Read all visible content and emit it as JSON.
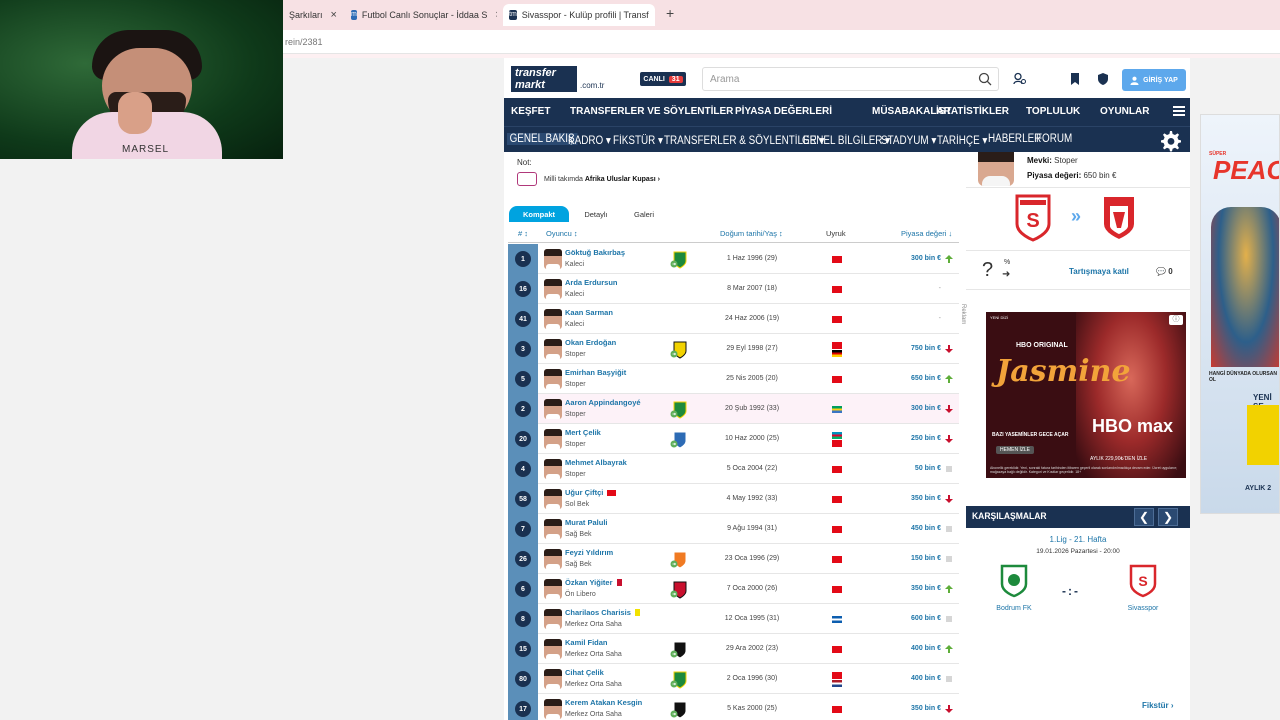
{
  "browser": {
    "tabs": [
      {
        "title": "Şarkıları",
        "active": false
      },
      {
        "title": "Futbol Canlı Sonuçlar - İddaa S",
        "active": false
      },
      {
        "title": "Sivasspor - Kulüp profili | Transf",
        "active": true
      }
    ],
    "new_tab_label": "+",
    "address": "rein/2381"
  },
  "webcam": {
    "shirt_text": "MARSEL"
  },
  "site": {
    "logo_text": "transfer markt",
    "logo_tld": ".com.tr",
    "live_label": "CANLI",
    "live_count": "31",
    "search_placeholder": "Arama",
    "login_label": "GİRİŞ YAP",
    "main_nav": [
      "KEŞFET",
      "TRANSFERLER VE SÖYLENTİLER",
      "PİYASA DEĞERLERİ",
      "MÜSABAKALAR",
      "İSTATİSTİKLER",
      "TOPLULUK",
      "OYUNLAR"
    ],
    "sub_nav": [
      "GENEL BAKIŞ",
      "KADRO ▾",
      "FİKSTÜR ▾",
      "TRANSFERLER & SÖYLENTİLER ▾",
      "GENEL BİLGİLER ▾",
      "STADYUM ▾",
      "TARİHÇE ▾",
      "HABERLER",
      "FORUM"
    ],
    "accent": "#1a3151",
    "link_color": "#1d75a8"
  },
  "notes": {
    "label": "Not:",
    "text_prefix": "Milli takımda",
    "text_bold": "Afrika Uluslar Kupası ›"
  },
  "view_tabs": [
    "Kompakt",
    "Detaylı",
    "Galeri"
  ],
  "table": {
    "headers": {
      "num": "# ↕",
      "player": "Oyuncu ↕",
      "birth": "Doğum tarihi/Yaş ↕",
      "nat": "Uyruk",
      "value": "Piyasa değeri ↓"
    },
    "rows": [
      {
        "num": "1",
        "name": "Göktuğ Bakırbaş",
        "pos": "Kaleci",
        "birth": "1 Haz 1996 (29)",
        "value": "300 bin €",
        "trend": "up",
        "club": "green",
        "flags": [
          "tr"
        ],
        "card": ""
      },
      {
        "num": "16",
        "name": "Arda Erdursun",
        "pos": "Kaleci",
        "birth": "8 Mar 2007 (18)",
        "value": "-",
        "trend": "none",
        "club": "",
        "flags": [
          "tr"
        ],
        "card": ""
      },
      {
        "num": "41",
        "name": "Kaan Sarman",
        "pos": "Kaleci",
        "birth": "24 Haz 2006 (19)",
        "value": "-",
        "trend": "none",
        "club": "",
        "flags": [
          "tr"
        ],
        "card": ""
      },
      {
        "num": "3",
        "name": "Okan Erdoğan",
        "pos": "Stoper",
        "birth": "29 Eyl 1998 (27)",
        "value": "750 bin €",
        "trend": "down",
        "club": "yellow-black",
        "flags": [
          "tr",
          "de"
        ],
        "card": ""
      },
      {
        "num": "5",
        "name": "Emirhan Başyiğit",
        "pos": "Stoper",
        "birth": "25 Nis 2005 (20)",
        "value": "650 bin €",
        "trend": "up",
        "club": "",
        "flags": [
          "tr"
        ],
        "card": ""
      },
      {
        "num": "2",
        "name": "Aaron Appindangoyé",
        "pos": "Stoper",
        "birth": "20 Şub 1992 (33)",
        "value": "300 bin €",
        "trend": "down",
        "club": "green",
        "flags": [
          "ga"
        ],
        "card": ""
      },
      {
        "num": "20",
        "name": "Mert Çelik",
        "pos": "Stoper",
        "birth": "10 Haz 2000 (25)",
        "value": "250 bin €",
        "trend": "down",
        "club": "blue",
        "flags": [
          "az",
          "tr"
        ],
        "card": ""
      },
      {
        "num": "4",
        "name": "Mehmet Albayrak",
        "pos": "Stoper",
        "birth": "5 Oca 2004 (22)",
        "value": "50 bin €",
        "trend": "same",
        "club": "",
        "flags": [
          "tr"
        ],
        "card": ""
      },
      {
        "num": "58",
        "name": "Uğur Çiftçi",
        "pos": "Sol Bek",
        "birth": "4 May 1992 (33)",
        "value": "350 bin €",
        "trend": "down",
        "club": "",
        "flags": [
          "tr"
        ],
        "card": "tr"
      },
      {
        "num": "7",
        "name": "Murat Paluli",
        "pos": "Sağ Bek",
        "birth": "9 Ağu 1994 (31)",
        "value": "450 bin €",
        "trend": "same",
        "club": "",
        "flags": [
          "tr"
        ],
        "card": ""
      },
      {
        "num": "26",
        "name": "Feyzi Yıldırım",
        "pos": "Sağ Bek",
        "birth": "23 Oca 1996 (29)",
        "value": "150 bin €",
        "trend": "same",
        "club": "orange",
        "flags": [
          "tr"
        ],
        "card": ""
      },
      {
        "num": "6",
        "name": "Özkan Yiğiter",
        "pos": "Ön Libero",
        "birth": "7 Oca 2000 (26)",
        "value": "350 bin €",
        "trend": "up",
        "club": "red-black",
        "flags": [
          "tr"
        ],
        "card": "red"
      },
      {
        "num": "8",
        "name": "Charilaos Charisis",
        "pos": "Merkez Orta Saha",
        "birth": "12 Oca 1995 (31)",
        "value": "600 bin €",
        "trend": "same",
        "club": "",
        "flags": [
          "gr"
        ],
        "card": "yellow"
      },
      {
        "num": "15",
        "name": "Kamil Fidan",
        "pos": "Merkez Orta Saha",
        "birth": "29 Ara 2002 (23)",
        "value": "400 bin €",
        "trend": "up",
        "club": "black-white",
        "flags": [
          "tr"
        ],
        "card": ""
      },
      {
        "num": "80",
        "name": "Cihat Çelik",
        "pos": "Merkez Orta Saha",
        "birth": "2 Oca 1996 (30)",
        "value": "400 bin €",
        "trend": "same",
        "club": "green",
        "flags": [
          "tr",
          "nl"
        ],
        "card": ""
      },
      {
        "num": "17",
        "name": "Kerem Atakan Kesgin",
        "pos": "Merkez Orta Saha",
        "birth": "5 Kas 2000 (25)",
        "value": "350 bin €",
        "trend": "down",
        "club": "black-white",
        "flags": [
          "tr"
        ],
        "card": ""
      }
    ]
  },
  "transfer_card": {
    "position_label": "Mevki:",
    "position_value": "Stoper",
    "value_label": "Piyasa değeri:",
    "value_value": "650 bin €",
    "rumor_pct": "%",
    "discuss_label": "Tartışmaya katıl",
    "discuss_count": "0"
  },
  "ad": {
    "label": "Reklam",
    "small": "YENİ DİZİ",
    "brand": "HBO ORIGINAL",
    "title": "Jasmine",
    "tagline": "BAZI YASEMİNLER GECE AÇAR",
    "cta": "HEMEN İZLE",
    "logo": "HBO max",
    "price": "AYLIK 229,90₺'DEN İZLE",
    "fine_print": "Abonelik gereklidir. Yeni, sonraki fatura tarihinden itibaren geçerli olarak sonlandırılmadıkça devam eder. Ücret uygulanır; mağazaya bağlı değildir. Kategori ve Kısıtlar geçerlidir. 18+"
  },
  "matches": {
    "title": "KARŞILAŞMALAR",
    "prev": "❮",
    "next": "❯",
    "league": "1.Lig - 21. Hafta",
    "date": "19.01.2026 Pazartesi - 20:00",
    "score": "-:-",
    "home": "Bodrum FK",
    "away": "Sivasspor",
    "fixture_link": "Fikstür ›"
  },
  "banner": {
    "sub": "SÜPER",
    "title": "PEACE",
    "small": "HANGİ DÜNYADA OLURSAN OL",
    "new": "YENİ SE",
    "bottom": "AYLIK 2"
  }
}
